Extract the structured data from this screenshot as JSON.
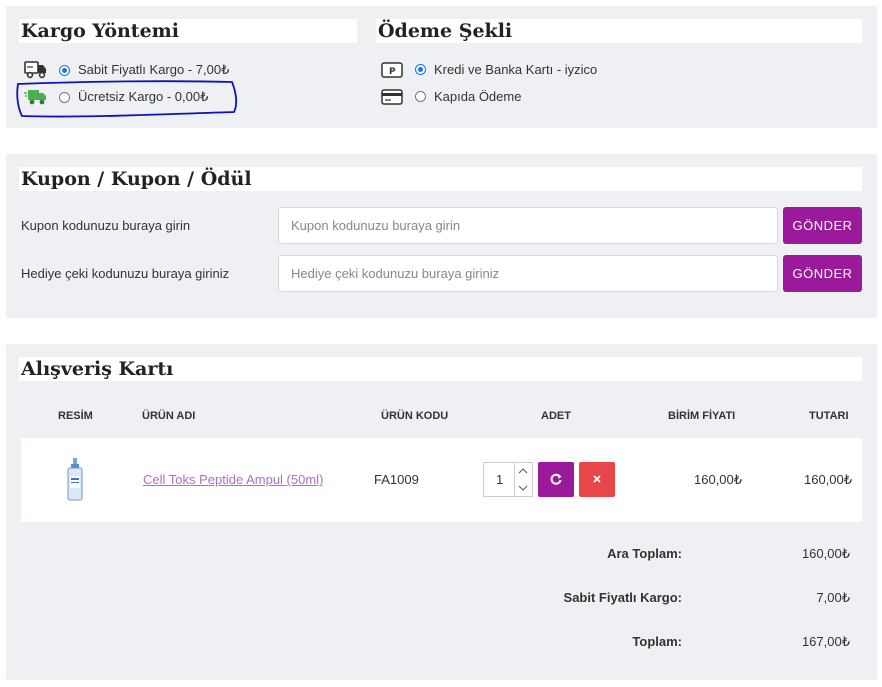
{
  "shipping": {
    "title": "Kargo Yöntemi",
    "options": [
      {
        "label": "Sabit Fiyatlı Kargo - 7,00₺",
        "selected": true,
        "icon": "truck-icon"
      },
      {
        "label": "Ücretsiz Kargo - 0,00₺",
        "selected": false,
        "icon": "fast-truck-icon"
      }
    ]
  },
  "payment": {
    "title": "Ödeme Şekli",
    "options": [
      {
        "label": "Kredi ve Banka Kartı - iyzico",
        "selected": true,
        "icon": "paypal-card-icon"
      },
      {
        "label": "Kapıda Ödeme",
        "selected": false,
        "icon": "credit-card-icon"
      }
    ]
  },
  "coupon": {
    "title": "Kupon / Kupon / Ödül",
    "rows": [
      {
        "label": "Kupon kodunuzu buraya girin",
        "placeholder": "Kupon kodunuzu buraya girin",
        "button": "GÖNDER"
      },
      {
        "label": "Hediye çeki kodunuzu buraya giriniz",
        "placeholder": "Hediye çeki kodunuzu buraya giriniz",
        "button": "GÖNDER"
      }
    ]
  },
  "cart": {
    "title": "Alışveriş Kartı",
    "headers": {
      "image": "RESİM",
      "name": "ÜRÜN ADI",
      "code": "ÜRÜN KODU",
      "qty": "ADET",
      "unit_price": "BİRİM FİYATI",
      "total": "TUTARI"
    },
    "items": [
      {
        "name": "Cell Toks Peptide Ampul (50ml)",
        "code": "FA1009",
        "qty": "1",
        "unit_price": "160,00₺",
        "total": "160,00₺"
      }
    ],
    "totals": [
      {
        "label": "Ara Toplam:",
        "value": "160,00₺"
      },
      {
        "label": "Sabit Fiyatlı Kargo:",
        "value": "7,00₺"
      },
      {
        "label": "Toplam:",
        "value": "167,00₺"
      }
    ]
  },
  "colors": {
    "accent": "#9b1a9b",
    "remove": "#e8474a",
    "radio": "#1a73e8",
    "link": "#b06fc0",
    "annotation": "#1212b5"
  }
}
